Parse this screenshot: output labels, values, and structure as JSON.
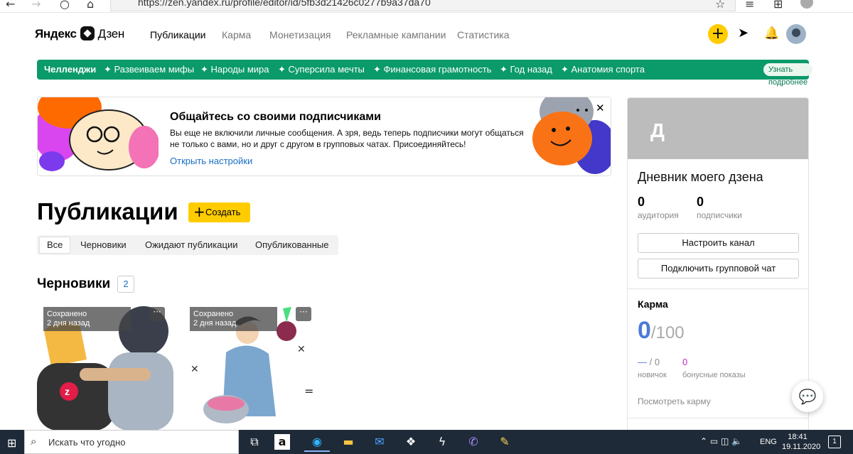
{
  "browser": {
    "url": "https://zen.yandex.ru/profile/editor/id/5fb3d21426c0277b9a37da70"
  },
  "header": {
    "logo_brand": "Яндекс",
    "logo_product": "Дзен",
    "nav": [
      "Публикации",
      "Карма",
      "Монетизация",
      "Рекламные кампании",
      "Статистика"
    ],
    "create_icon": "plus-icon",
    "icons": [
      "send-icon",
      "bell-icon",
      "avatar"
    ]
  },
  "challenges": {
    "label": "Челленджи",
    "items": [
      "Развеиваем мифы",
      "Народы мира",
      "Суперсила мечты",
      "Финансовая грамотность",
      "Год назад",
      "Анатомия спорта"
    ],
    "learn_more": "Узнать подробнее",
    "color": "#0b9a6a"
  },
  "banner": {
    "title": "Общайтесь со своими подписчиками",
    "text": "Вы еще не включили личные сообщения. А зря, ведь теперь подписчики могут общаться не только с вами, но и друг с другом в групповых чатах. Присоединяйтесь!",
    "link": "Открыть настройки"
  },
  "publications": {
    "title": "Публикации",
    "create_label": "Создать",
    "tabs": [
      "Все",
      "Черновики",
      "Ожидают публикации",
      "Опубликованные"
    ],
    "selected_tab": "Все"
  },
  "drafts": {
    "title": "Черновики",
    "count": "2",
    "cards": [
      {
        "status": "Сохранено",
        "time": "2 дня назад"
      },
      {
        "status": "Сохранено",
        "time": "2 дня назад"
      }
    ]
  },
  "sidebar": {
    "cover_letter": "Д",
    "channel_name": "Дневник моего дзена",
    "audience_value": "0",
    "audience_label": "аудитория",
    "subscribers_value": "0",
    "subscribers_label": "подписчики",
    "configure_button": "Настроить канал",
    "group_chat_button": "Подключить групповой чат",
    "karma_title": "Карма",
    "karma_value": "0",
    "karma_max": "/100",
    "novice_dash": "—",
    "novice_value": "/ 0",
    "novice_label": "новичок",
    "bonus_value": "0",
    "bonus_label": "бонусные показы",
    "see_karma": "Посмотреть карму",
    "accent": "#4d7ad8"
  },
  "taskbar": {
    "search_placeholder": "Искать что угодно",
    "lang": "ENG",
    "time": "18:41",
    "date": "19.11.2020",
    "notifications": "1"
  }
}
